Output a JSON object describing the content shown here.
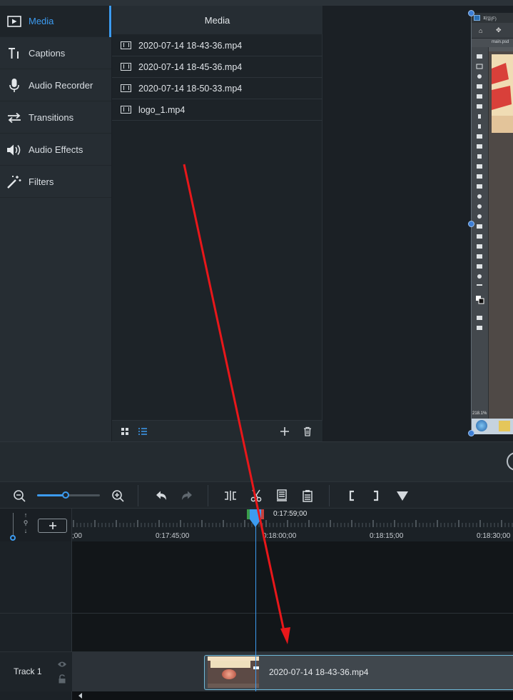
{
  "sidebar": {
    "items": [
      {
        "label": "Media",
        "icon": "media-icon",
        "active": true
      },
      {
        "label": "Captions",
        "icon": "captions-icon",
        "active": false
      },
      {
        "label": "Audio Recorder",
        "icon": "microphone-icon",
        "active": false
      },
      {
        "label": "Transitions",
        "icon": "transitions-icon",
        "active": false
      },
      {
        "label": "Audio Effects",
        "icon": "speaker-icon",
        "active": false
      },
      {
        "label": "Filters",
        "icon": "magic-wand-icon",
        "active": false
      }
    ]
  },
  "media_panel": {
    "title": "Media",
    "files": [
      {
        "name": "2020-07-14 18-43-36.mp4"
      },
      {
        "name": "2020-07-14 18-45-36.mp4"
      },
      {
        "name": "2020-07-14 18-50-33.mp4"
      },
      {
        "name": "logo_1.mp4"
      }
    ]
  },
  "preview": {
    "window_title": "파일(F)",
    "doc_tab": "main.psd",
    "zoom": "218.1%"
  },
  "toolbar": {
    "zoom_level": 0.45
  },
  "timeline": {
    "playhead_time": "0:17:59;00",
    "ruler_labels": [
      ";00",
      "0:17:45;00",
      "0:18:00;00",
      "0:18:15;00",
      "0:18:30;00"
    ],
    "tracks": [
      {
        "label": "Track 1",
        "clip": "2020-07-14 18-43-36.mp4"
      }
    ]
  },
  "colors": {
    "accent": "#3c9bf0",
    "annotation_arrow": "#e8171a"
  }
}
